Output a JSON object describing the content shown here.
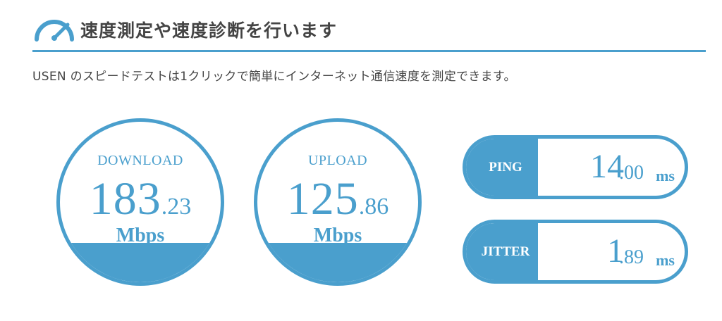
{
  "header": {
    "title": "速度測定や速度診断を行います",
    "icon": "gauge-icon",
    "accent_color": "#4a9fcd"
  },
  "description": "USEN のスピードテストは1クリックで簡単にインターネット通信速度を測定できます。",
  "download": {
    "label": "DOWNLOAD",
    "integer": "183",
    "decimal": ".23",
    "unit": "Mbps"
  },
  "upload": {
    "label": "UPLOAD",
    "integer": "125",
    "decimal": ".86",
    "unit": "Mbps"
  },
  "ping": {
    "label": "PING",
    "integer": "14",
    "decimal": ".00",
    "unit": "ms"
  },
  "jitter": {
    "label": "JITTER",
    "integer": "1",
    "decimal": ".89",
    "unit": "ms"
  }
}
